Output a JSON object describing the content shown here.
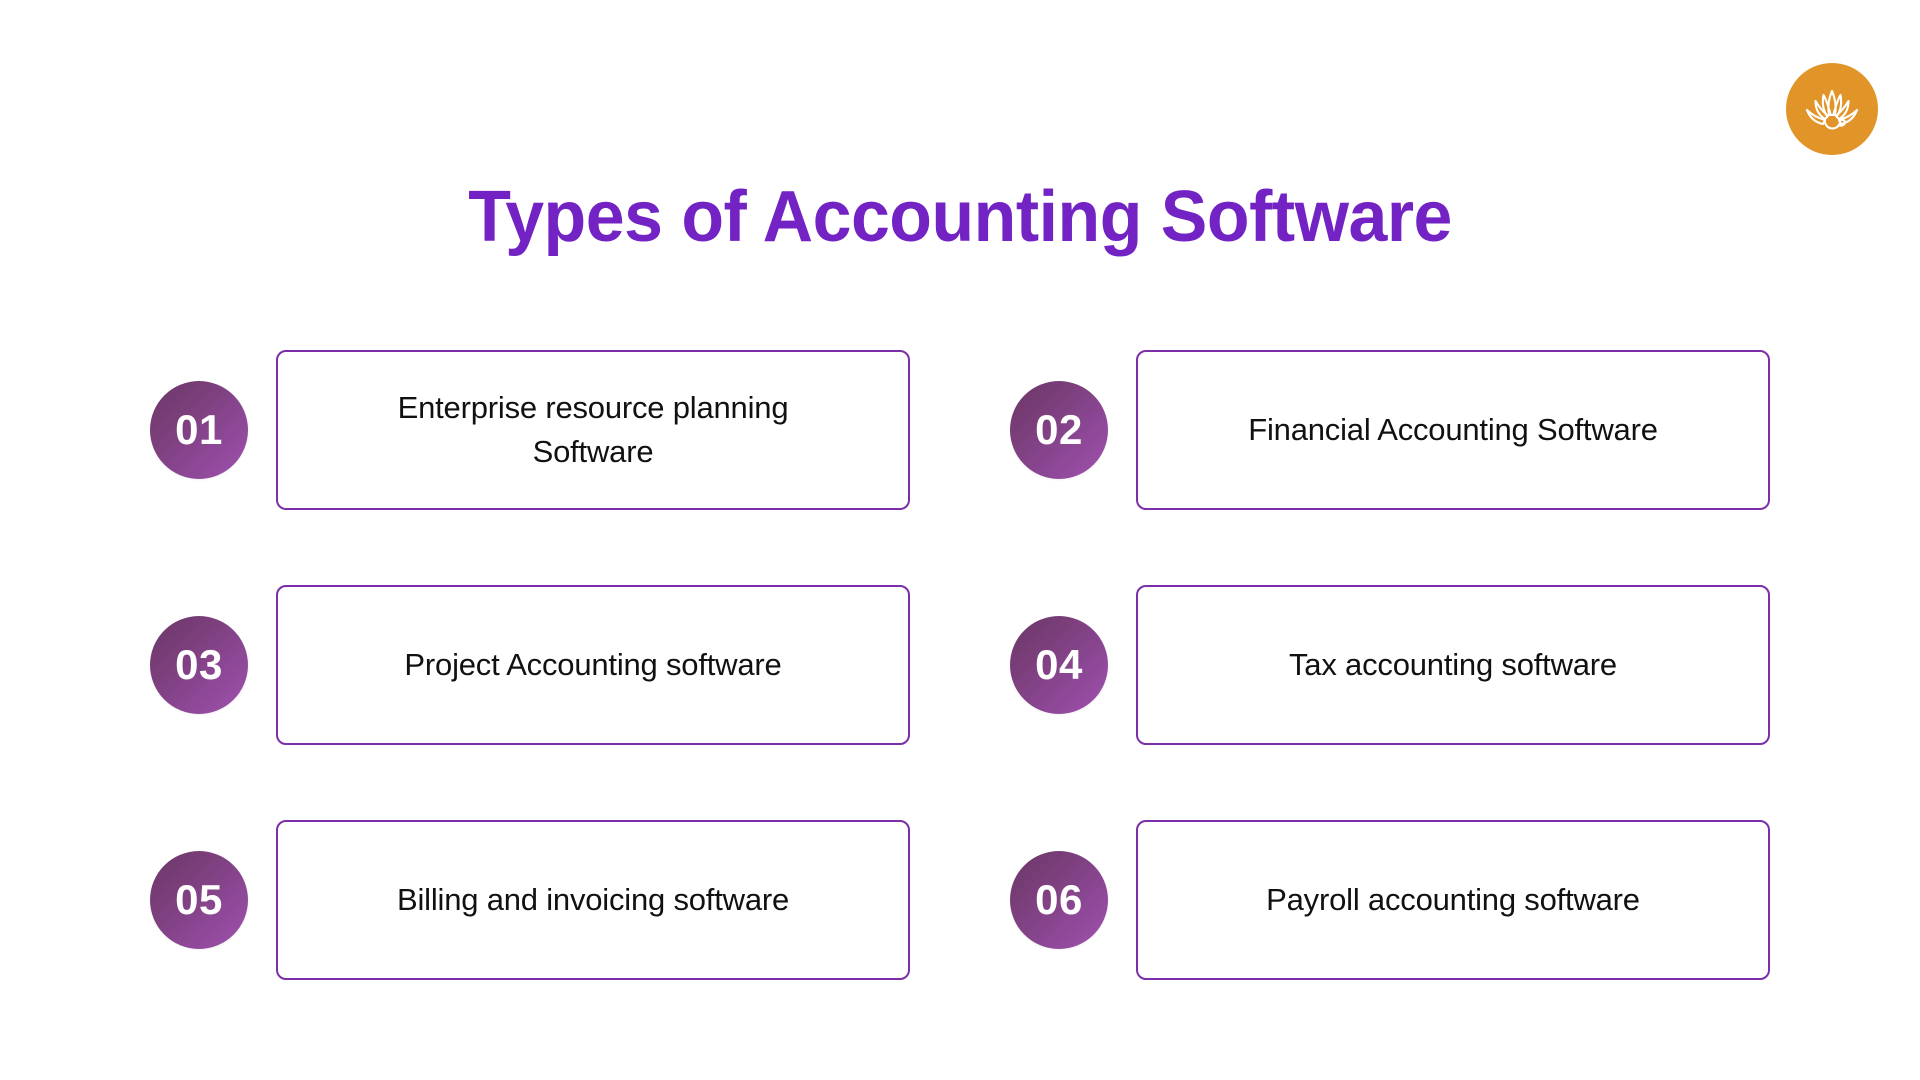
{
  "page": {
    "background_color": "#ffffff",
    "title": "Types of Accounting Software",
    "title_color": "#7322C4"
  },
  "logo": {
    "name": "lotus-logo",
    "background_color": "#E19529",
    "glyph_color": "#FFFFFF",
    "icon": "lotus-icon"
  },
  "style": {
    "box_border_color": "#7B2FA8",
    "circle_gradient_start": "#6A3766",
    "circle_gradient_end": "#A052AE",
    "number_text_color": "#FFFFFF",
    "item_text_color": "#111111"
  },
  "items": [
    {
      "number": "01",
      "label": "Enterprise resource planning Software",
      "column": "left",
      "row": 1
    },
    {
      "number": "02",
      "label": "Financial Accounting Software",
      "column": "right",
      "row": 1
    },
    {
      "number": "03",
      "label": "Project Accounting software",
      "column": "left",
      "row": 2
    },
    {
      "number": "04",
      "label": "Tax accounting software",
      "column": "right",
      "row": 2
    },
    {
      "number": "05",
      "label": "Billing and invoicing software",
      "column": "left",
      "row": 3
    },
    {
      "number": "06",
      "label": "Payroll accounting software",
      "column": "right",
      "row": 3
    }
  ]
}
